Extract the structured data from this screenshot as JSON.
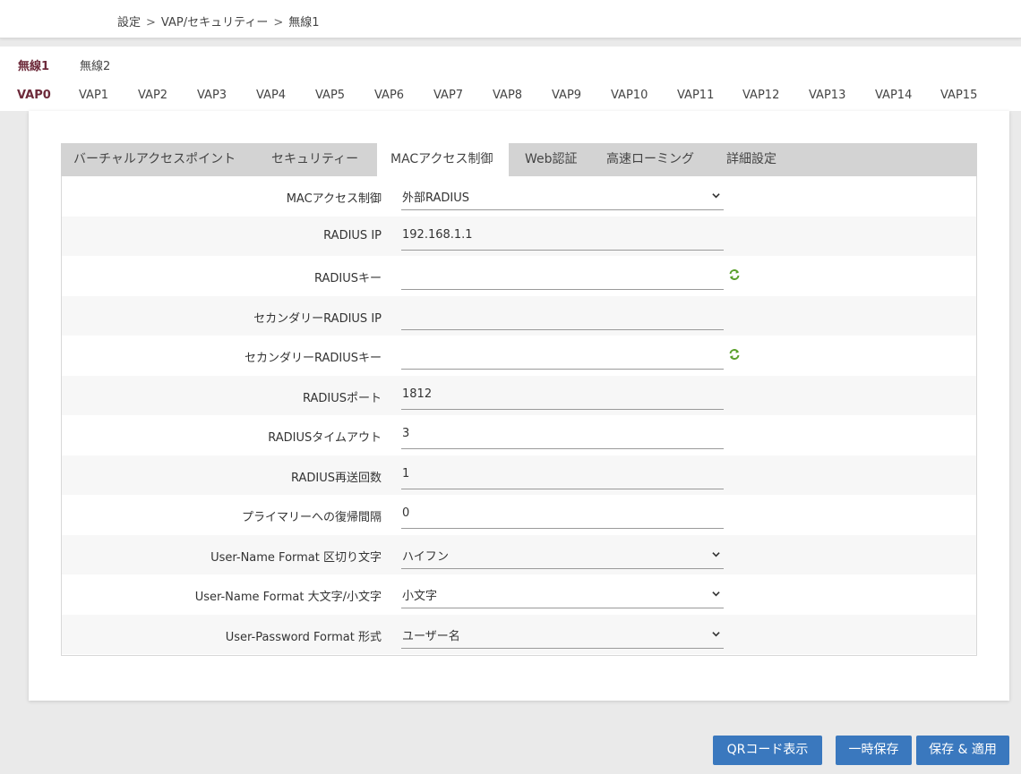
{
  "breadcrumb": [
    "設定",
    "VAP/セキュリティー",
    "無線1"
  ],
  "radios": [
    {
      "label": "無線1",
      "active": true
    },
    {
      "label": "無線2",
      "active": false
    }
  ],
  "vaps": [
    "VAP0",
    "VAP1",
    "VAP2",
    "VAP3",
    "VAP4",
    "VAP5",
    "VAP6",
    "VAP7",
    "VAP8",
    "VAP9",
    "VAP10",
    "VAP11",
    "VAP12",
    "VAP13",
    "VAP14",
    "VAP15"
  ],
  "active_vap": "VAP0",
  "subtabs": [
    "バーチャルアクセスポイント",
    "セキュリティー",
    "MACアクセス制御",
    "Web認証",
    "高速ローミング",
    "詳細設定"
  ],
  "active_subtab": "MACアクセス制御",
  "form": {
    "mac_access": {
      "label": "MACアクセス制御",
      "value": "外部RADIUS"
    },
    "radius_ip": {
      "label": "RADIUS IP",
      "value": "192.168.1.1"
    },
    "radius_key": {
      "label": "RADIUSキー",
      "value": ""
    },
    "secondary_ip": {
      "label": "セカンダリーRADIUS IP",
      "value": ""
    },
    "secondary_key": {
      "label": "セカンダリーRADIUSキー",
      "value": ""
    },
    "radius_port": {
      "label": "RADIUSポート",
      "value": "1812"
    },
    "radius_timeout": {
      "label": "RADIUSタイムアウト",
      "value": "3"
    },
    "radius_retry": {
      "label": "RADIUS再送回数",
      "value": "1"
    },
    "primary_return": {
      "label": "プライマリーへの復帰間隔",
      "value": "0"
    },
    "un_delimiter": {
      "label": "User-Name Format 区切り文字",
      "value": "ハイフン"
    },
    "un_case": {
      "label": "User-Name Format 大文字/小文字",
      "value": "小文字"
    },
    "pw_format": {
      "label": "User-Password Format 形式",
      "value": "ユーザー名"
    }
  },
  "buttons": {
    "qr": "QRコード表示",
    "temp_save": "一時保存",
    "save_apply": "保存 & 適用"
  },
  "colors": {
    "accent_tab": "#6d2a3a",
    "button": "#3a78be",
    "refresh_icon": "#5aa02c"
  }
}
